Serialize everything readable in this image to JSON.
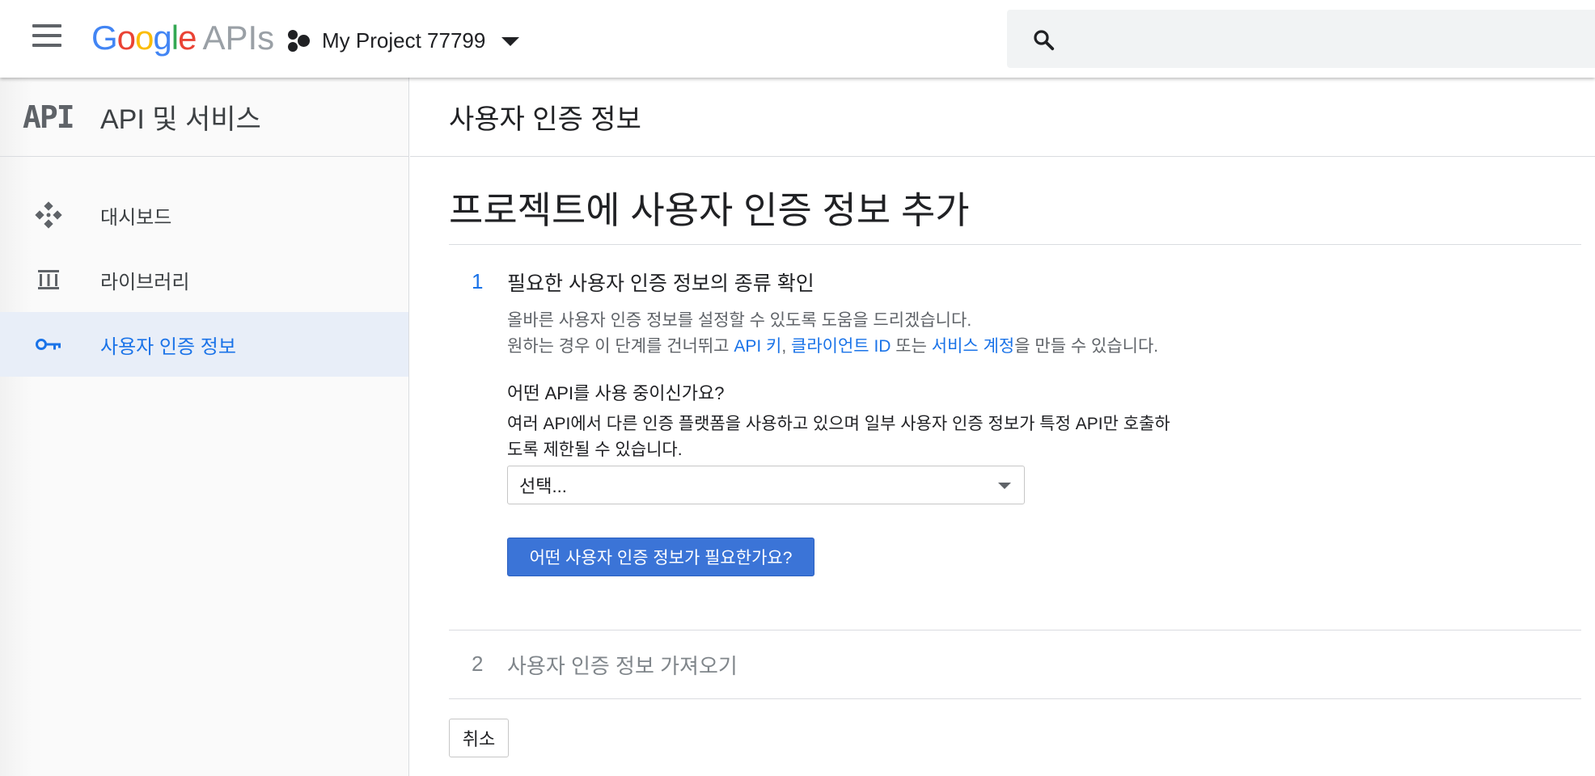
{
  "topbar": {
    "logo_letters": [
      "G",
      "o",
      "o",
      "g",
      "l",
      "e"
    ],
    "logo_suffix": "APIs",
    "project_name": "My Project 77799",
    "icons": {
      "menu": "hamburger-menu-icon",
      "project": "project-dots-icon",
      "dropdown": "caret-down-icon",
      "search": "search-icon"
    }
  },
  "sidebar": {
    "logo_text": "API",
    "title": "API 및 서비스",
    "items": [
      {
        "label": "대시보드",
        "icon": "dashboard-icon",
        "active": false
      },
      {
        "label": "라이브러리",
        "icon": "library-icon",
        "active": false
      },
      {
        "label": "사용자 인증 정보",
        "icon": "key-icon",
        "active": true
      }
    ]
  },
  "main": {
    "page_title": "사용자 인증 정보",
    "heading": "프로젝트에 사용자 인증 정보 추가",
    "step1": {
      "number": "1",
      "title": "필요한 사용자 인증 정보의 종류 확인",
      "desc_line1": "올바른 사용자 인증 정보를 설정할 수 있도록 도움을 드리겠습니다.",
      "desc_line2_prefix": "원하는 경우 이 단계를 건너뛰고 ",
      "link_api_key": "API 키",
      "comma": ", ",
      "link_client_id": "클라이언트 ID",
      "or": " 또는 ",
      "link_service_account": "서비스 계정",
      "desc_line2_suffix": "을 만들 수 있습니다.",
      "question": "어떤 API를 사용 중이신가요?",
      "question_desc_line1": "여러 API에서 다른 인증 플랫폼을 사용하고 있으며 일부 사용자 인증 정보가 특정 API만 호출하",
      "question_desc_line2": "도록 제한될 수 있습니다.",
      "select_value": "선택...",
      "button_label": "어떤 사용자 인증 정보가 필요한가요?"
    },
    "step2": {
      "number": "2",
      "title": "사용자 인증 정보 가져오기"
    },
    "cancel_label": "취소"
  },
  "colors": {
    "accent": "#1a73e8",
    "primary_button": "#3b74d7",
    "sidebar_active_bg": "#e8eef8"
  }
}
